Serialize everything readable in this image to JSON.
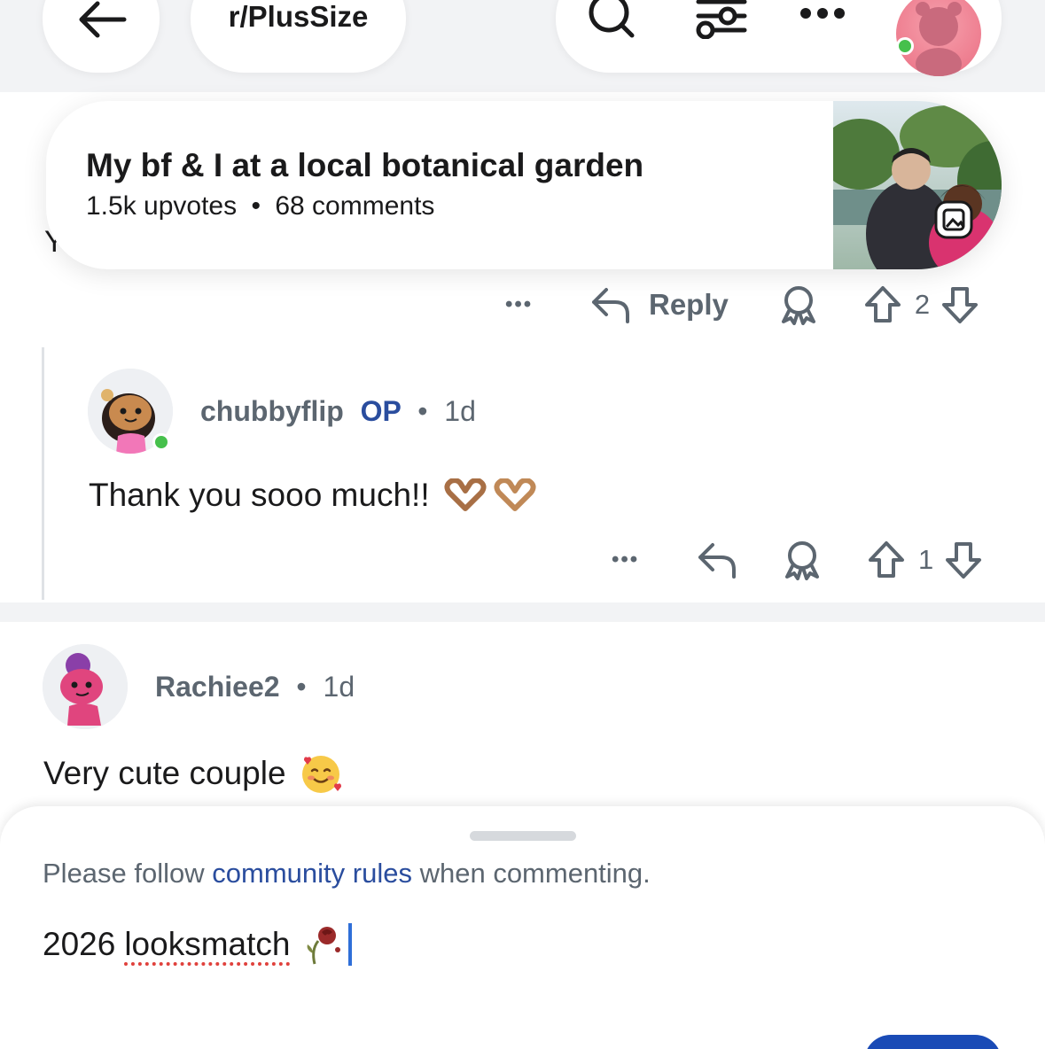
{
  "nav": {
    "subreddit": "r/PlusSize",
    "icons": [
      "back-arrow-icon",
      "search-icon",
      "filter-icon",
      "more-icon"
    ]
  },
  "post": {
    "title": "My bf & I at a local botanical garden",
    "upvotes": "1.5k upvotes",
    "comments": "68 comments",
    "separator": "•"
  },
  "parent_comment": {
    "partial_text": "Yo",
    "more": "•••",
    "reply_label": "Reply",
    "votes": "2"
  },
  "reply_comment": {
    "author": "chubbyflip",
    "op_badge": "OP",
    "age": "1d",
    "separator": "•",
    "body": "Thank you sooo much!!",
    "more": "•••",
    "votes": "1"
  },
  "comment_rachiee": {
    "author": "Rachiee2",
    "age": "1d",
    "separator": "•",
    "body": "Very cute couple"
  },
  "composer": {
    "rules_prefix": "Please follow",
    "rules_link": "community rules",
    "rules_suffix": "when commenting.",
    "draft_prefix": "2026",
    "draft_misspelled": "looksmatch"
  },
  "colors": {
    "accent": "#2a4d9e",
    "online": "#46c04c",
    "caret": "#2f6fd8",
    "button": "#1a4bb6"
  }
}
